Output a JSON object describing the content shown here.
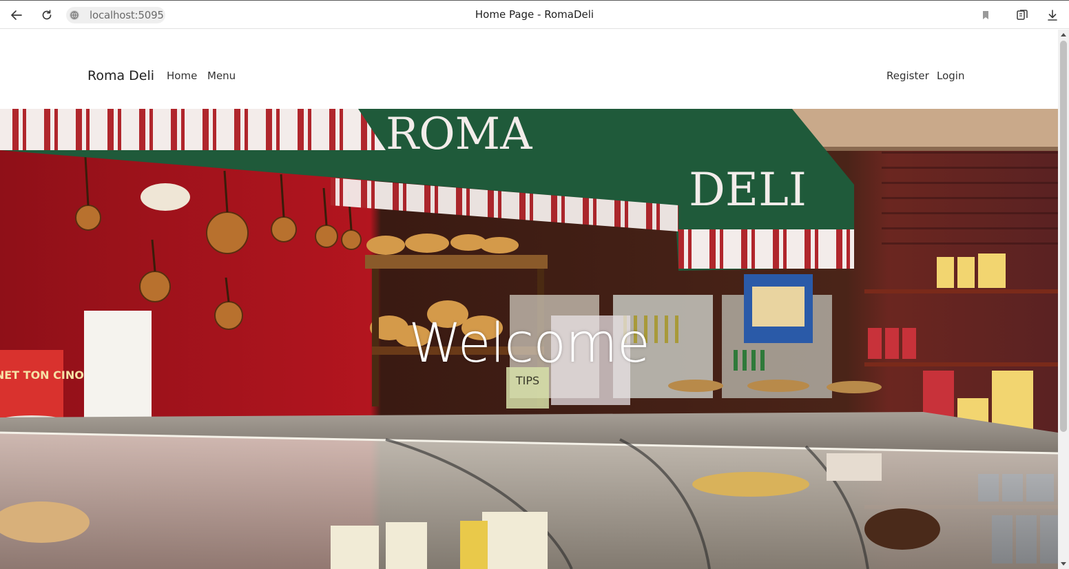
{
  "browser": {
    "url": "localhost:5095",
    "tab_title": "Home Page - RomaDeli"
  },
  "navbar": {
    "brand": "Roma Deli",
    "links": [
      {
        "label": "Home"
      },
      {
        "label": "Menu"
      }
    ],
    "auth": [
      {
        "label": "Register"
      },
      {
        "label": "Login"
      }
    ]
  },
  "hero": {
    "title": "Welcome",
    "awning_text_1": "ROMA",
    "awning_text_2": "DELI",
    "sign_text": "PANET TON CINO",
    "tips_text": "TIPS"
  },
  "colors": {
    "awning_green": "#1f5a3a",
    "wall_red": "#a3121c",
    "wood_brown": "#5a2a22"
  }
}
